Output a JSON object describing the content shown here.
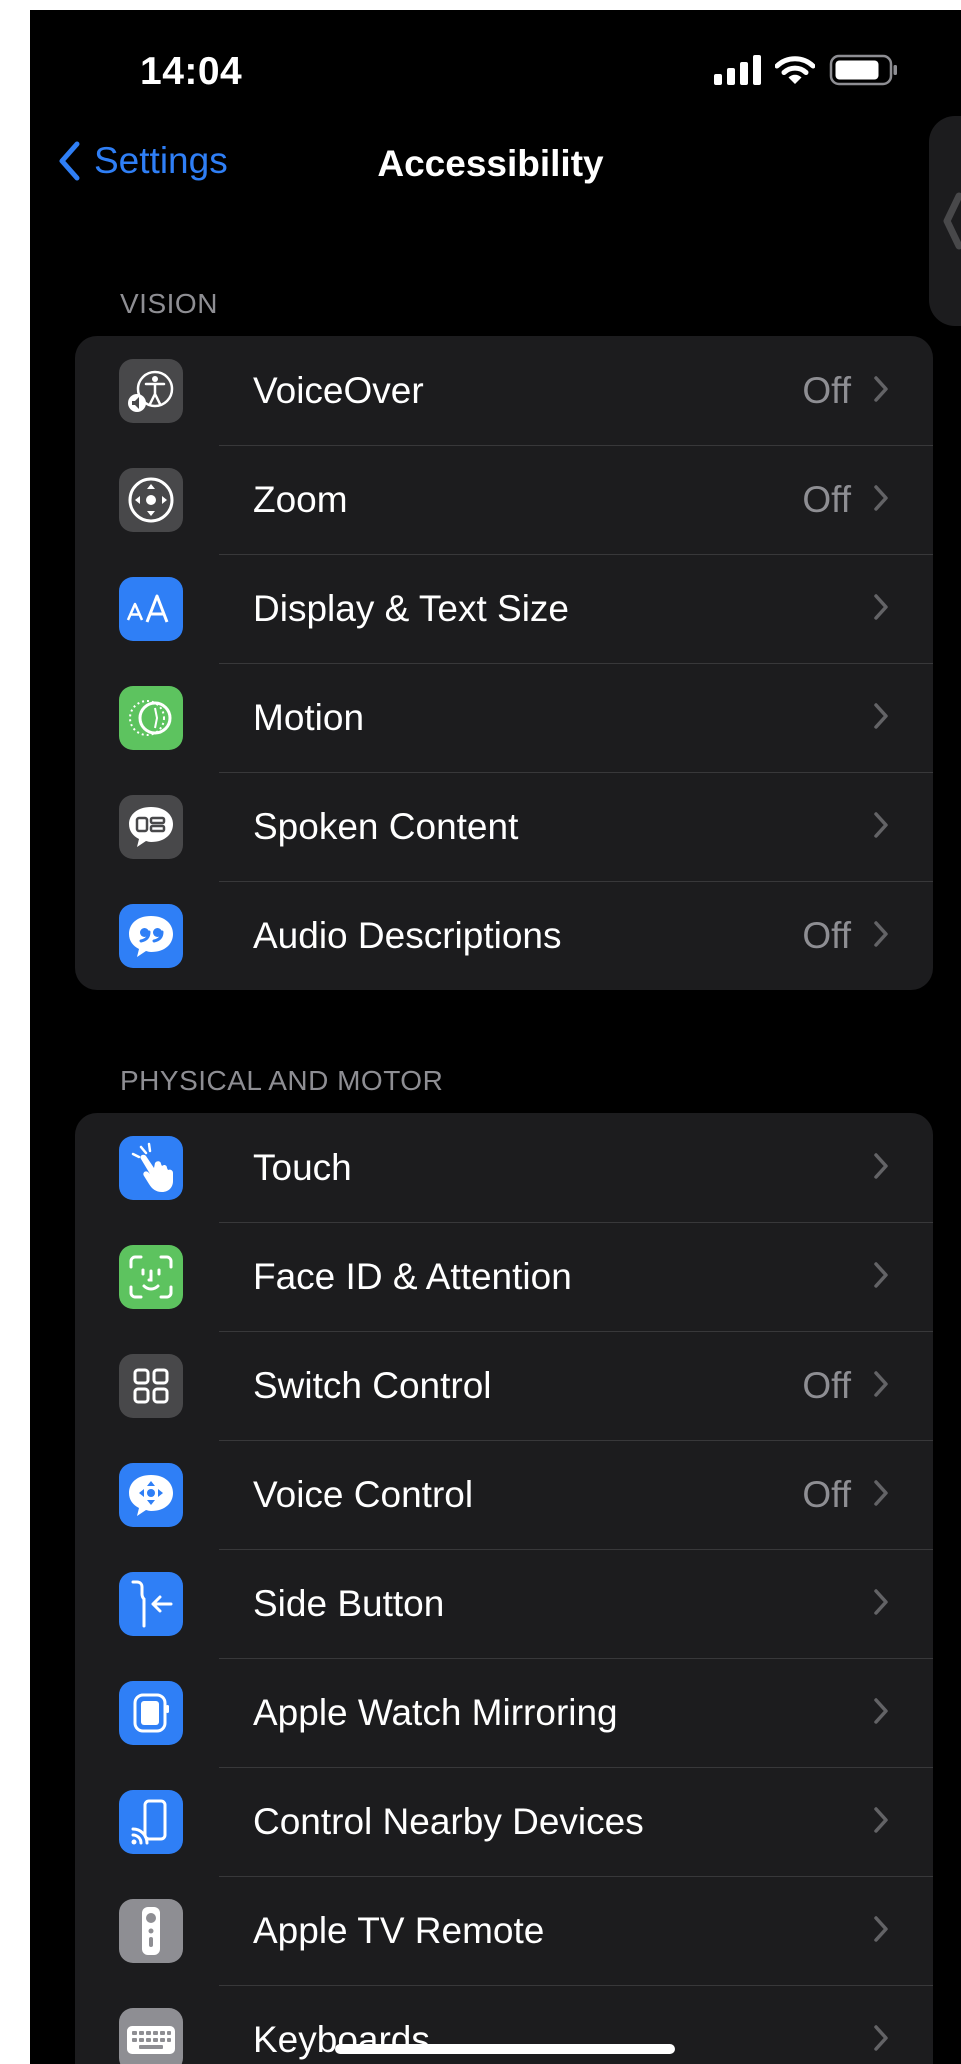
{
  "status_bar": {
    "time": "14:04"
  },
  "nav": {
    "back_label": "Settings",
    "title": "Accessibility"
  },
  "sections": [
    {
      "header": "VISION",
      "items": [
        {
          "label": "VoiceOver",
          "value": "Off",
          "icon": "voiceover-icon",
          "icon_bg": "#48484a"
        },
        {
          "label": "Zoom",
          "value": "Off",
          "icon": "zoom-icon",
          "icon_bg": "#48484a"
        },
        {
          "label": "Display & Text Size",
          "value": "",
          "icon": "display-text-size-icon",
          "icon_bg": "#2f7ff6"
        },
        {
          "label": "Motion",
          "value": "",
          "icon": "motion-icon",
          "icon_bg": "#5dc35f"
        },
        {
          "label": "Spoken Content",
          "value": "",
          "icon": "spoken-content-icon",
          "icon_bg": "#48484a"
        },
        {
          "label": "Audio Descriptions",
          "value": "Off",
          "icon": "audio-descriptions-icon",
          "icon_bg": "#2f7ff6"
        }
      ]
    },
    {
      "header": "PHYSICAL AND MOTOR",
      "items": [
        {
          "label": "Touch",
          "value": "",
          "icon": "touch-icon",
          "icon_bg": "#2f7ff6"
        },
        {
          "label": "Face ID & Attention",
          "value": "",
          "icon": "face-id-icon",
          "icon_bg": "#5dc35f"
        },
        {
          "label": "Switch Control",
          "value": "Off",
          "icon": "switch-control-icon",
          "icon_bg": "#48484a"
        },
        {
          "label": "Voice Control",
          "value": "Off",
          "icon": "voice-control-icon",
          "icon_bg": "#2f7ff6"
        },
        {
          "label": "Side Button",
          "value": "",
          "icon": "side-button-icon",
          "icon_bg": "#2f7ff6"
        },
        {
          "label": "Apple Watch Mirroring",
          "value": "",
          "icon": "apple-watch-mirroring-icon",
          "icon_bg": "#2f7ff6"
        },
        {
          "label": "Control Nearby Devices",
          "value": "",
          "icon": "control-nearby-devices-icon",
          "icon_bg": "#2f7ff6"
        },
        {
          "label": "Apple TV Remote",
          "value": "",
          "icon": "apple-tv-remote-icon",
          "icon_bg": "#8e8e93"
        },
        {
          "label": "Keyboards",
          "value": "",
          "icon": "keyboard-icon",
          "icon_bg": "#8e8e93"
        }
      ]
    }
  ],
  "colors": {
    "background": "#000000",
    "group_background": "#1c1c1e",
    "accent": "#2f7ff6",
    "secondary_text": "#8e8e93",
    "separator": "#38383a"
  }
}
